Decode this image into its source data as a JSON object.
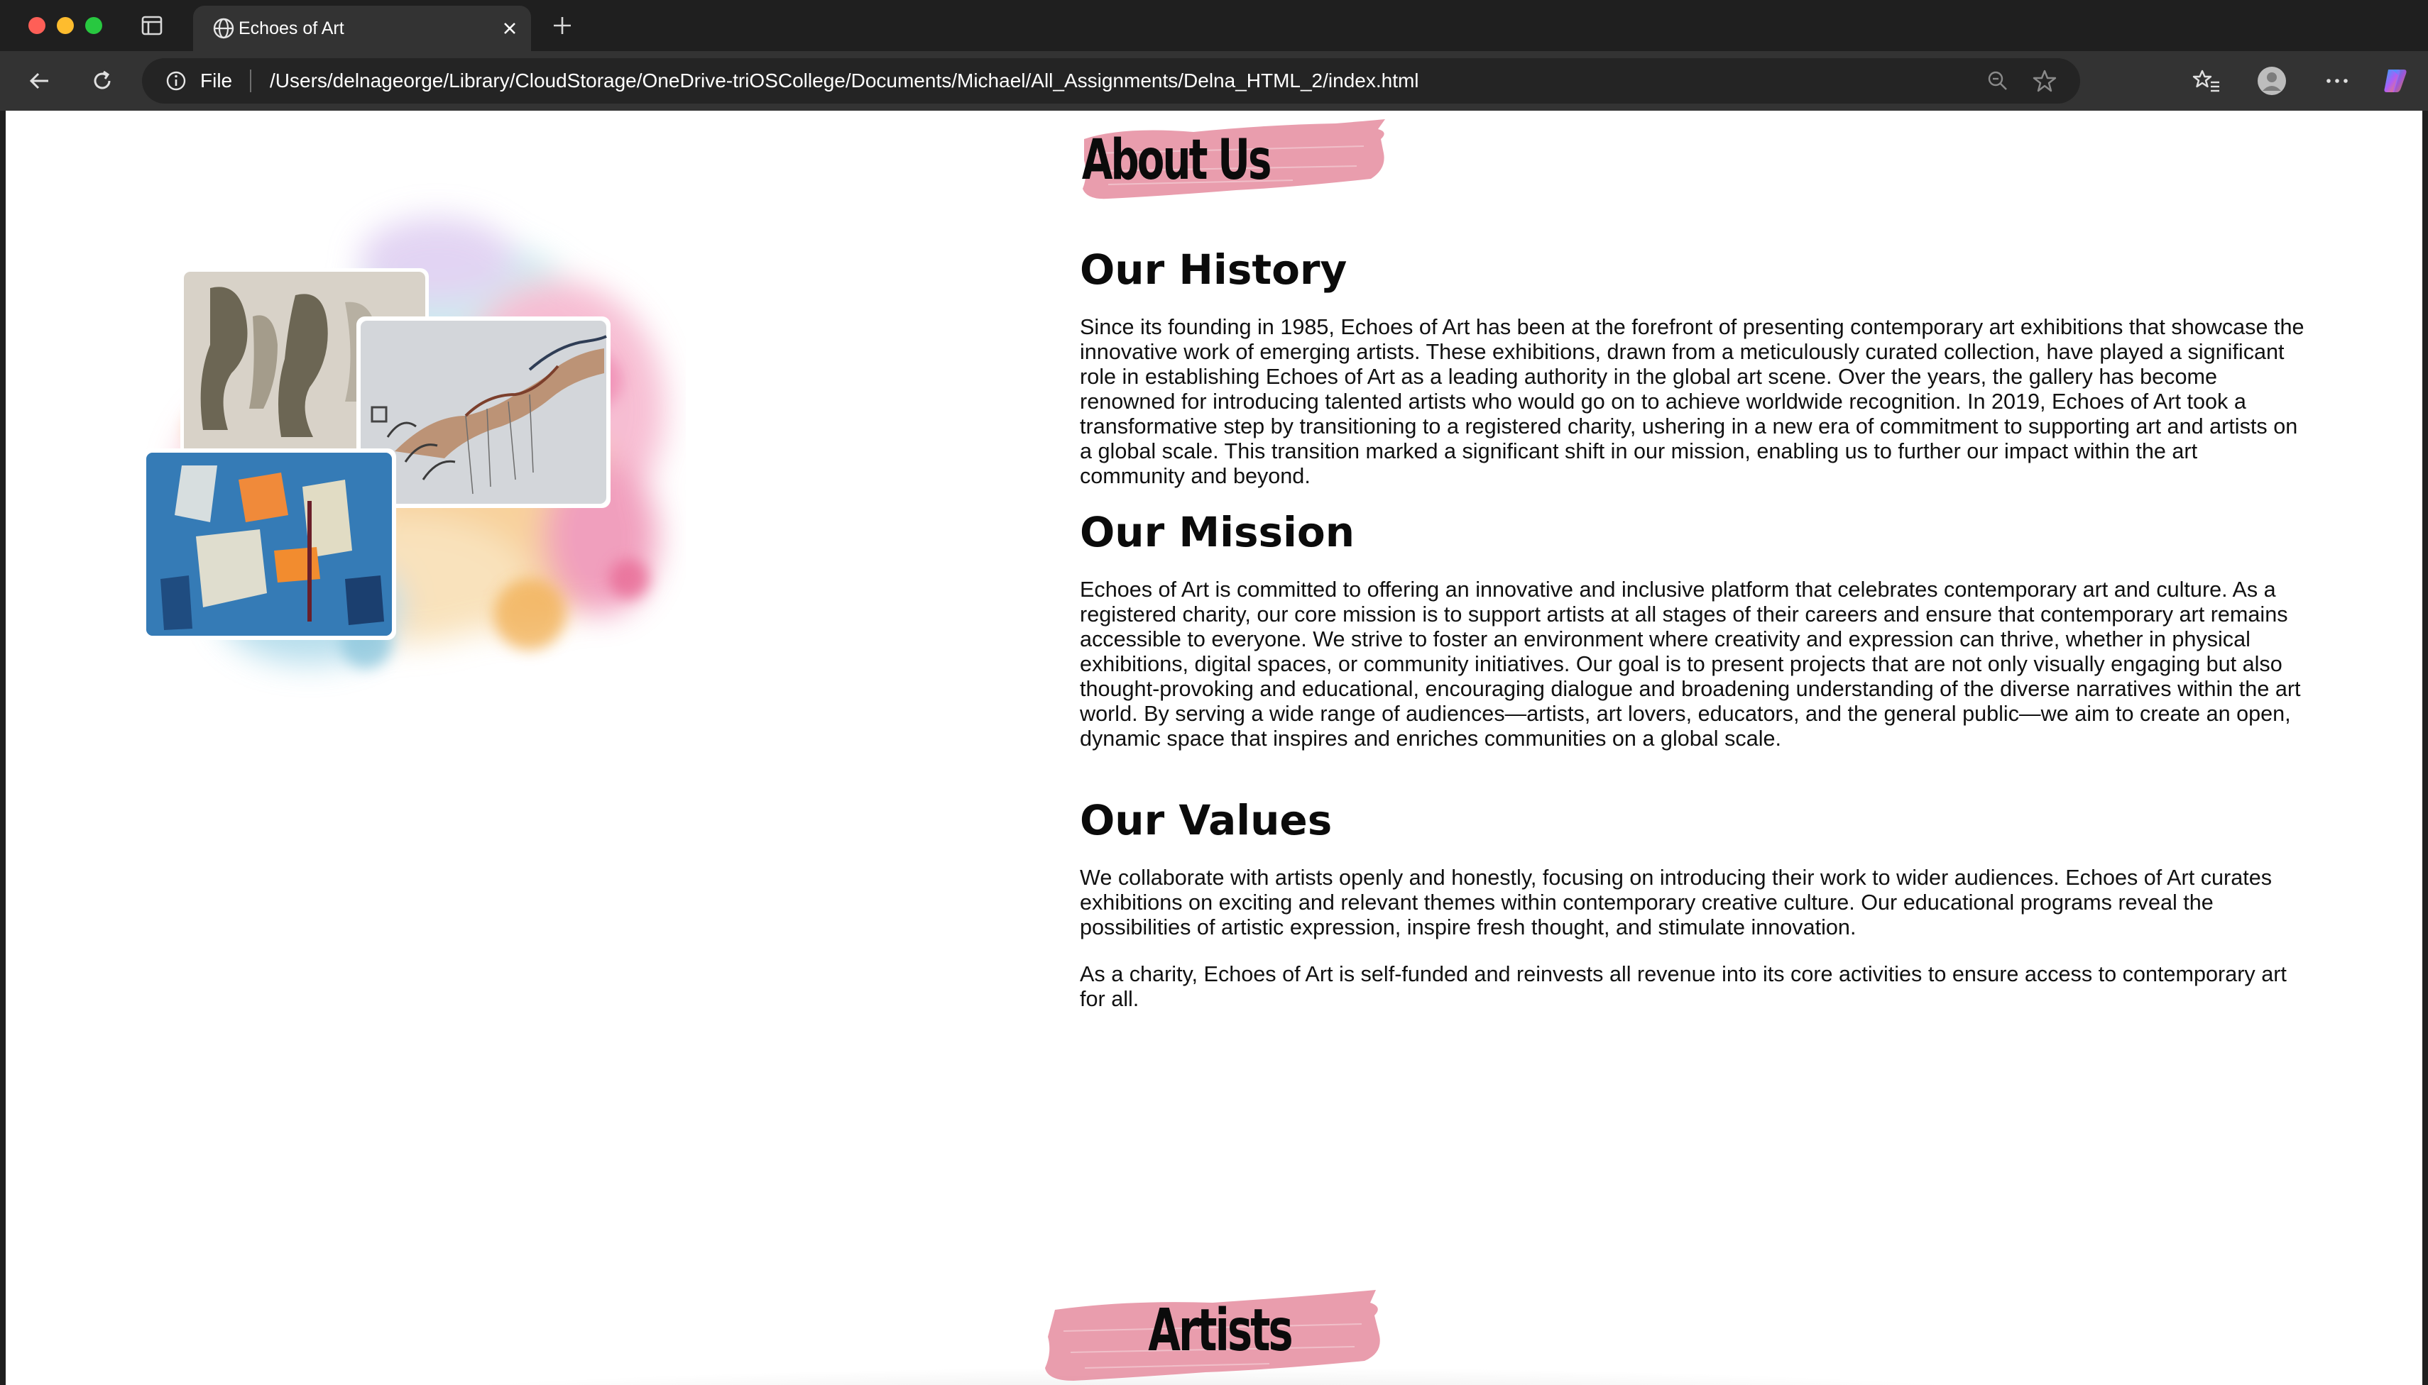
{
  "browser": {
    "tab": {
      "title": "Echoes of Art",
      "favicon": "globe-icon"
    },
    "toolbar": {
      "scheme_label": "File",
      "url": "/Users/delnageorge/Library/CloudStorage/OneDrive-triOSCollege/Documents/Michael/All_Assignments/Delna_HTML_2/index.html"
    }
  },
  "page": {
    "about_heading": "About Us",
    "sections": [
      {
        "title": "Our History",
        "paragraphs": [
          "Since its founding in 1985, Echoes of Art has been at the forefront of presenting contemporary art exhibitions that showcase the innovative work of emerging artists. These exhibitions, drawn from a meticulously curated collection, have played a significant role in establishing Echoes of Art as a leading authority in the global art scene. Over the years, the gallery has become renowned for introducing talented artists who would go on to achieve worldwide recognition. In 2019, Echoes of Art took a transformative step by transitioning to a registered charity, ushering in a new era of commitment to supporting art and artists on a global scale. This transition marked a significant shift in our mission, enabling us to further our impact within the art community and beyond."
        ]
      },
      {
        "title": "Our Mission",
        "paragraphs": [
          "Echoes of Art is committed to offering an innovative and inclusive platform that celebrates contemporary art and culture. As a registered charity, our core mission is to support artists at all stages of their careers and ensure that contemporary art remains accessible to everyone. We strive to foster an environment where creativity and expression can thrive, whether in physical exhibitions, digital spaces, or community initiatives. Our goal is to present projects that are not only visually engaging but also thought-provoking and educational, encouraging dialogue and broadening understanding of the diverse narratives within the art world. By serving a wide range of audiences—artists, art lovers, educators, and the general public—we aim to create an open, dynamic space that inspires and enriches communities on a global scale."
        ]
      },
      {
        "title": "Our Values",
        "paragraphs": [
          "We collaborate with artists openly and honestly, focusing on introducing their work to wider audiences. Echoes of Art curates exhibitions on exciting and relevant themes within contemporary creative culture. Our educational programs reveal the possibilities of artistic expression, inspire fresh thought, and stimulate innovation.",
          "As a charity, Echoes of Art is self-funded and reinvests all revenue into its core activities to ensure access to contemporary art for all."
        ]
      }
    ],
    "artists_heading": "Artists"
  },
  "colors": {
    "brush_stroke": "#e58c9f",
    "window_chrome": "#1f1f1f",
    "toolbar": "#333333",
    "omnibox": "#242424"
  }
}
